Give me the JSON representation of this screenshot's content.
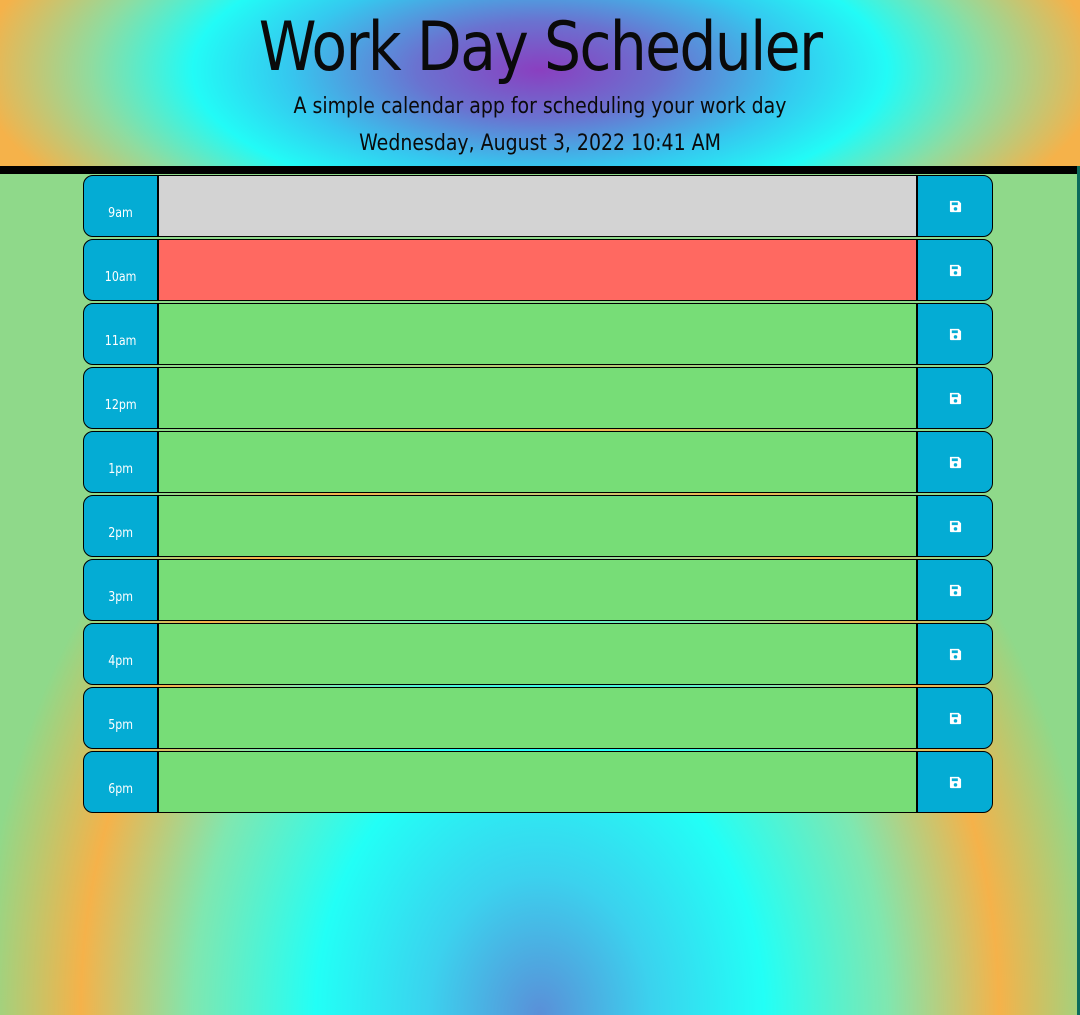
{
  "header": {
    "title": "Work Day Scheduler",
    "subtitle": "A simple calendar app for scheduling your work day",
    "current_datetime": "Wednesday, August 3, 2022 10:41 AM"
  },
  "colors": {
    "hour_bg": "#04acd4",
    "past": "#d3d3d3",
    "present": "#ff6961",
    "future": "#77dd77"
  },
  "timeblocks": [
    {
      "hour": "9am",
      "status": "past",
      "text": "",
      "save_icon": "save-icon"
    },
    {
      "hour": "10am",
      "status": "present",
      "text": "",
      "save_icon": "save-icon"
    },
    {
      "hour": "11am",
      "status": "future",
      "text": "",
      "save_icon": "save-icon"
    },
    {
      "hour": "12pm",
      "status": "future",
      "text": "",
      "save_icon": "save-icon"
    },
    {
      "hour": "1pm",
      "status": "future",
      "text": "",
      "save_icon": "save-icon"
    },
    {
      "hour": "2pm",
      "status": "future",
      "text": "",
      "save_icon": "save-icon"
    },
    {
      "hour": "3pm",
      "status": "future",
      "text": "",
      "save_icon": "save-icon"
    },
    {
      "hour": "4pm",
      "status": "future",
      "text": "",
      "save_icon": "save-icon"
    },
    {
      "hour": "5pm",
      "status": "future",
      "text": "",
      "save_icon": "save-icon"
    },
    {
      "hour": "6pm",
      "status": "future",
      "text": "",
      "save_icon": "save-icon"
    }
  ]
}
